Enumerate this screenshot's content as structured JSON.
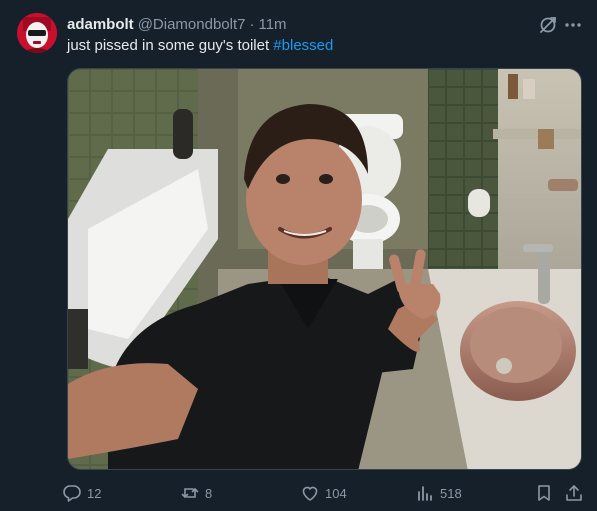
{
  "tweet": {
    "display_name": "adambolt",
    "handle": "@Diamondbolt7",
    "separator": "·",
    "time": "11m",
    "text_before": "just pissed in some guy's toilet ",
    "hashtag": "#blessed"
  },
  "actions": {
    "replies": "12",
    "reposts": "8",
    "likes": "104",
    "views": "518"
  },
  "colors": {
    "background": "#15202b",
    "text": "#e7e9ea",
    "muted": "#8b98a5",
    "link": "#1d9bf0"
  },
  "icons": {
    "grok": "grok-icon",
    "more": "more-icon",
    "reply": "reply-icon",
    "repost": "repost-icon",
    "like": "like-icon",
    "views": "views-icon",
    "bookmark": "bookmark-icon",
    "share": "share-icon"
  }
}
